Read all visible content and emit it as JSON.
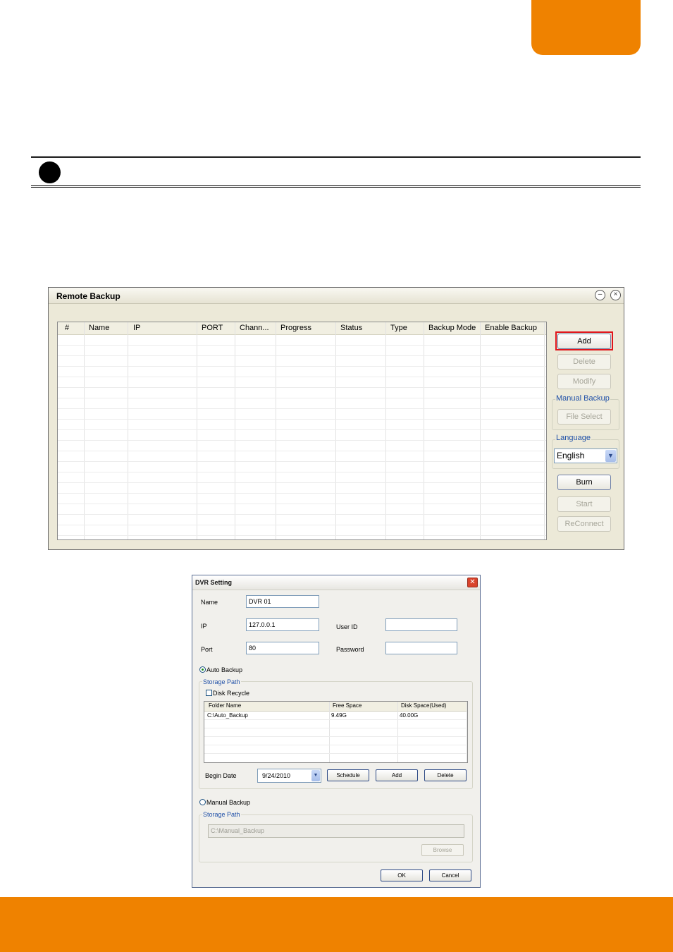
{
  "remote_backup": {
    "title": "Remote Backup",
    "columns": [
      "#",
      "Name",
      "IP",
      "PORT",
      "Chann...",
      "Progress",
      "Status",
      "Type",
      "Backup Mode",
      "Enable Backup"
    ],
    "buttons": {
      "add": "Add",
      "delete": "Delete",
      "modify": "Modify",
      "file_select": "File Select",
      "burn": "Burn",
      "start": "Start",
      "reconnect": "ReConnect"
    },
    "manual_backup_label": "Manual Backup",
    "language_label": "Language",
    "language_value": "English"
  },
  "dvr_setting": {
    "title": "DVR Setting",
    "name_label": "Name",
    "name_value": "DVR 01",
    "ip_label": "IP",
    "ip_value": "127.0.0.1",
    "port_label": "Port",
    "port_value": "80",
    "user_id_label": "User ID",
    "user_id_value": "",
    "password_label": "Password",
    "password_value": "",
    "auto_backup_label": "Auto Backup",
    "storage_path_label": "Storage Path",
    "disk_recycle_label": "Disk Recycle",
    "table_columns": [
      "Folder Name",
      "Free Space",
      "Disk Space(Used)"
    ],
    "table_rows": [
      [
        "C:\\Auto_Backup",
        "9.49G",
        "40.00G"
      ]
    ],
    "begin_date_label": "Begin Date",
    "begin_date_value": "9/24/2010",
    "schedule_button": "Schedule",
    "add_button": "Add",
    "delete_button": "Delete",
    "manual_backup_label": "Manual Backup",
    "manual_storage_path_label": "Storage Path",
    "manual_path_value": "C:\\Manual_Backup",
    "browse_button": "Browse",
    "ok_button": "OK",
    "cancel_button": "Cancel"
  },
  "colors": {
    "brand_orange": "#ef8200",
    "highlight_red": "#e0151c"
  }
}
